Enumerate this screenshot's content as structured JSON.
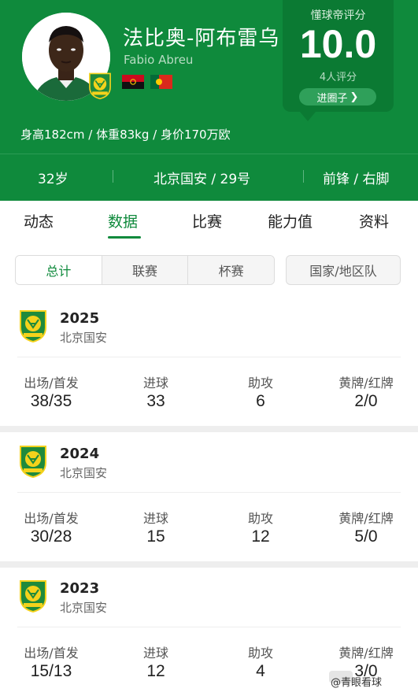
{
  "header": {
    "name_cn": "法比奥-阿布雷乌",
    "name_en": "Fabio Abreu",
    "physical": "身高182cm / 体重83kg / 身价170万欧",
    "age": "32岁",
    "club_number": "北京国安 / 29号",
    "position_foot": "前锋 / 右脚",
    "flags": [
      "angola-flag",
      "portugal-flag"
    ]
  },
  "rating": {
    "title": "懂球帝评分",
    "score": "10.0",
    "count": "4人评分",
    "enter_label": "进圈子"
  },
  "tabs": [
    {
      "label": "动态",
      "active": false
    },
    {
      "label": "数据",
      "active": true
    },
    {
      "label": "比赛",
      "active": false
    },
    {
      "label": "能力值",
      "active": false
    },
    {
      "label": "资料",
      "active": false
    }
  ],
  "filters": {
    "segments": [
      {
        "label": "总计",
        "active": true
      },
      {
        "label": "联赛",
        "active": false
      },
      {
        "label": "杯赛",
        "active": false
      }
    ],
    "national": "国家/地区队"
  },
  "stat_labels": {
    "apps": "出场/首发",
    "goals": "进球",
    "assists": "助攻",
    "cards": "黄牌/红牌"
  },
  "seasons": [
    {
      "year": "2025",
      "team": "北京国安",
      "apps": "38/35",
      "goals": "33",
      "assists": "6",
      "cards": "2/0"
    },
    {
      "year": "2024",
      "team": "北京国安",
      "apps": "30/28",
      "goals": "15",
      "assists": "12",
      "cards": "5/0"
    },
    {
      "year": "2023",
      "team": "北京国安",
      "apps": "15/13",
      "goals": "12",
      "assists": "4",
      "cards": "3/0"
    }
  ],
  "watermark": "@青眼看球",
  "colors": {
    "brand_green": "#0f8a3c",
    "card_green": "#0b7a33"
  }
}
